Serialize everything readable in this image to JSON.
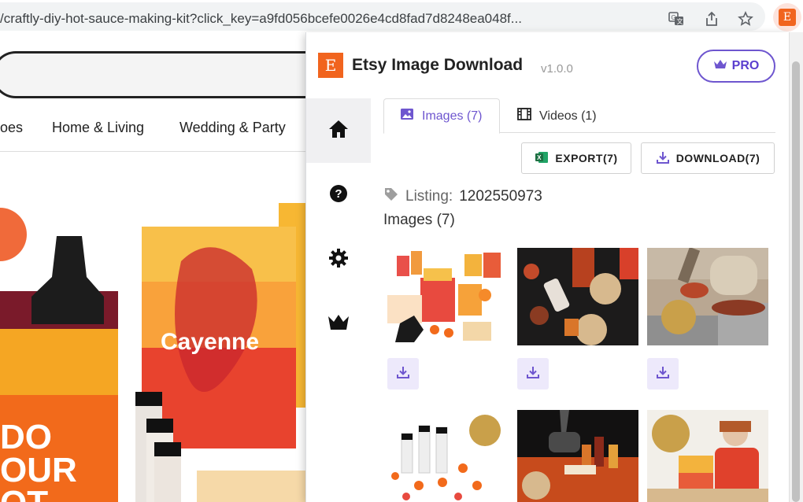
{
  "browser": {
    "url": "/craftly-diy-hot-sauce-making-kit?click_key=a9fd056bcefe0026e4cd8fad7d8248ea048f...",
    "ext_logo": "E"
  },
  "page": {
    "nav": [
      "oes",
      "Home & Living",
      "Wedding & Party"
    ]
  },
  "popup": {
    "logo": "E",
    "title": "Etsy Image Download",
    "version": "v1.0.0",
    "pro_label": "PRO",
    "tabs": [
      {
        "label": "Images (7)",
        "icon": "image-icon"
      },
      {
        "label": "Videos (1)",
        "icon": "film-icon"
      }
    ],
    "export_label": "EXPORT(7)",
    "download_label": "DOWNLOAD(7)",
    "listing_label": "Listing:",
    "listing_id": "1202550973",
    "images_heading": "Images (7)"
  },
  "colors": {
    "accent": "#6e56cf",
    "etsy_orange": "#f1641e",
    "excel_green": "#1d6f42"
  }
}
